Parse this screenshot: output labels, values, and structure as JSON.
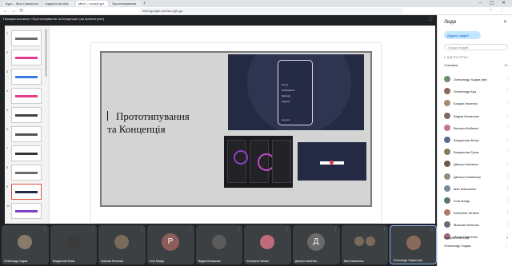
{
  "browser": {
    "tabs": [
      {
        "label": "Курс – Моя Classroom"
      },
      {
        "label": "Ходжа Ілля Маз"
      },
      {
        "label": "Meet – rui-prjh-jyz"
      },
      {
        "label": "Прототипування"
      }
    ],
    "new_tab": "+",
    "window_controls": "– ▢ ✕",
    "url": "meet.google.com/rui-prjh-jyz",
    "nav": {
      "back": "←",
      "forward": "→",
      "reload": "↻"
    },
    "extensions": "☆ ⋮"
  },
  "meet": {
    "presenting_info": "Показується вікно «Прототипування та Концепція» (ви презентуєте)",
    "expand": "⛶"
  },
  "slide": {
    "title_line1": "Прототипування",
    "title_line2": "та Концепція",
    "phone_menu": [
      "Home",
      "Notifications",
      "Settings",
      "Support"
    ],
    "phone_footer": "Log out"
  },
  "thumbnails": [
    {
      "num": "1",
      "color": "#6b6b6b"
    },
    {
      "num": "2",
      "color": "#e23b8a"
    },
    {
      "num": "3",
      "color": "#3a7be0"
    },
    {
      "num": "4",
      "color": "#e23b8a"
    },
    {
      "num": "5",
      "color": "#444444"
    },
    {
      "num": "6",
      "color": "#555555"
    },
    {
      "num": "7",
      "color": "#333333"
    },
    {
      "num": "8",
      "color": "#6b6b6b"
    },
    {
      "num": "9",
      "color": "#252a44"
    },
    {
      "num": "10",
      "color": "#7b3fc7"
    }
  ],
  "people_panel": {
    "title": "Люди",
    "close": "✕",
    "add_people": "Додати людей",
    "search_placeholder": "Пошук людей",
    "section": "У ЦІЙ ЗУСТРІЧІ",
    "contributors_label": "Учасники",
    "contributors_count": "21",
    "people": [
      {
        "name": "Олександр Ходжа (ви)",
        "color": "#6b8e6b",
        "icon": "⋮"
      },
      {
        "name": "Олександр Куц",
        "color": "#8a6b5b",
        "icon": "⋮"
      },
      {
        "name": "Богдан Ільченко",
        "color": "#a58b6f",
        "icon": "⋮"
      },
      {
        "name": "Вадим Калашник",
        "color": "#7a6a5e",
        "icon": "⋮"
      },
      {
        "name": "Вікторія Бабенко",
        "color": "#c07a8a",
        "icon": "⋮"
      },
      {
        "name": "Владислав Білик",
        "color": "#5b6b8a",
        "icon": "⋮"
      },
      {
        "name": "Владислав Гусак",
        "color": "#8a7a5b",
        "icon": "⋮"
      },
      {
        "name": "Дмитро Іваненко",
        "color": "#6b5b4b",
        "icon": "⋮"
      },
      {
        "name": "Дмитро Ковальчук",
        "color": "#9a8a7a",
        "icon": "⋮"
      },
      {
        "name": "Іван Коваленко",
        "color": "#7a8a9a",
        "icon": "⋮"
      },
      {
        "name": "Ілля Мазур",
        "color": "#5b7a6b",
        "icon": "⋮"
      },
      {
        "name": "Катерина Литвин",
        "color": "#b07a6a",
        "icon": "⋮"
      },
      {
        "name": "Максим Мельник",
        "color": "#6a6a7a",
        "icon": "⋮"
      },
      {
        "name": "Марія Павленко",
        "color": "#a06a7a",
        "icon": "⋮"
      }
    ],
    "footer": [
      {
        "label": "Очікують на вхід",
        "right": "1"
      },
      {
        "label": "Олександр Ходжа",
        "right": "⋮"
      }
    ]
  },
  "tiles": [
    {
      "name": "Олександр Ходжа",
      "kind": "face",
      "color": "#8a7a6a"
    },
    {
      "name": "Владислав Білик",
      "kind": "face",
      "color": "#3a3a3a"
    },
    {
      "name": "Максим Мельник",
      "kind": "face",
      "color": "#7a6a5a"
    },
    {
      "name": "Ілля Мазур",
      "kind": "letter",
      "letter": "Р",
      "color": "#8d5d5a"
    },
    {
      "name": "Вадим Калашник",
      "kind": "face",
      "color": "#5a5a5a"
    },
    {
      "name": "Катерина Литвин",
      "kind": "face",
      "color": "#c06a7a"
    },
    {
      "name": "Дмитро Іваненко",
      "kind": "letter",
      "letter": "Д",
      "color": "#6a6a6a"
    },
    {
      "name": "Іван Коваленко",
      "kind": "pair",
      "color": "#7a6a5a"
    },
    {
      "name": "Олександр Ходжа (ви)",
      "kind": "face",
      "color": "#8a6b5b",
      "active": true
    }
  ],
  "colors": {
    "accent": "#8ab4f8",
    "meet_bg": "#202124",
    "tile_bg": "#3c4043",
    "slide_bg": "#d4d4d4"
  }
}
